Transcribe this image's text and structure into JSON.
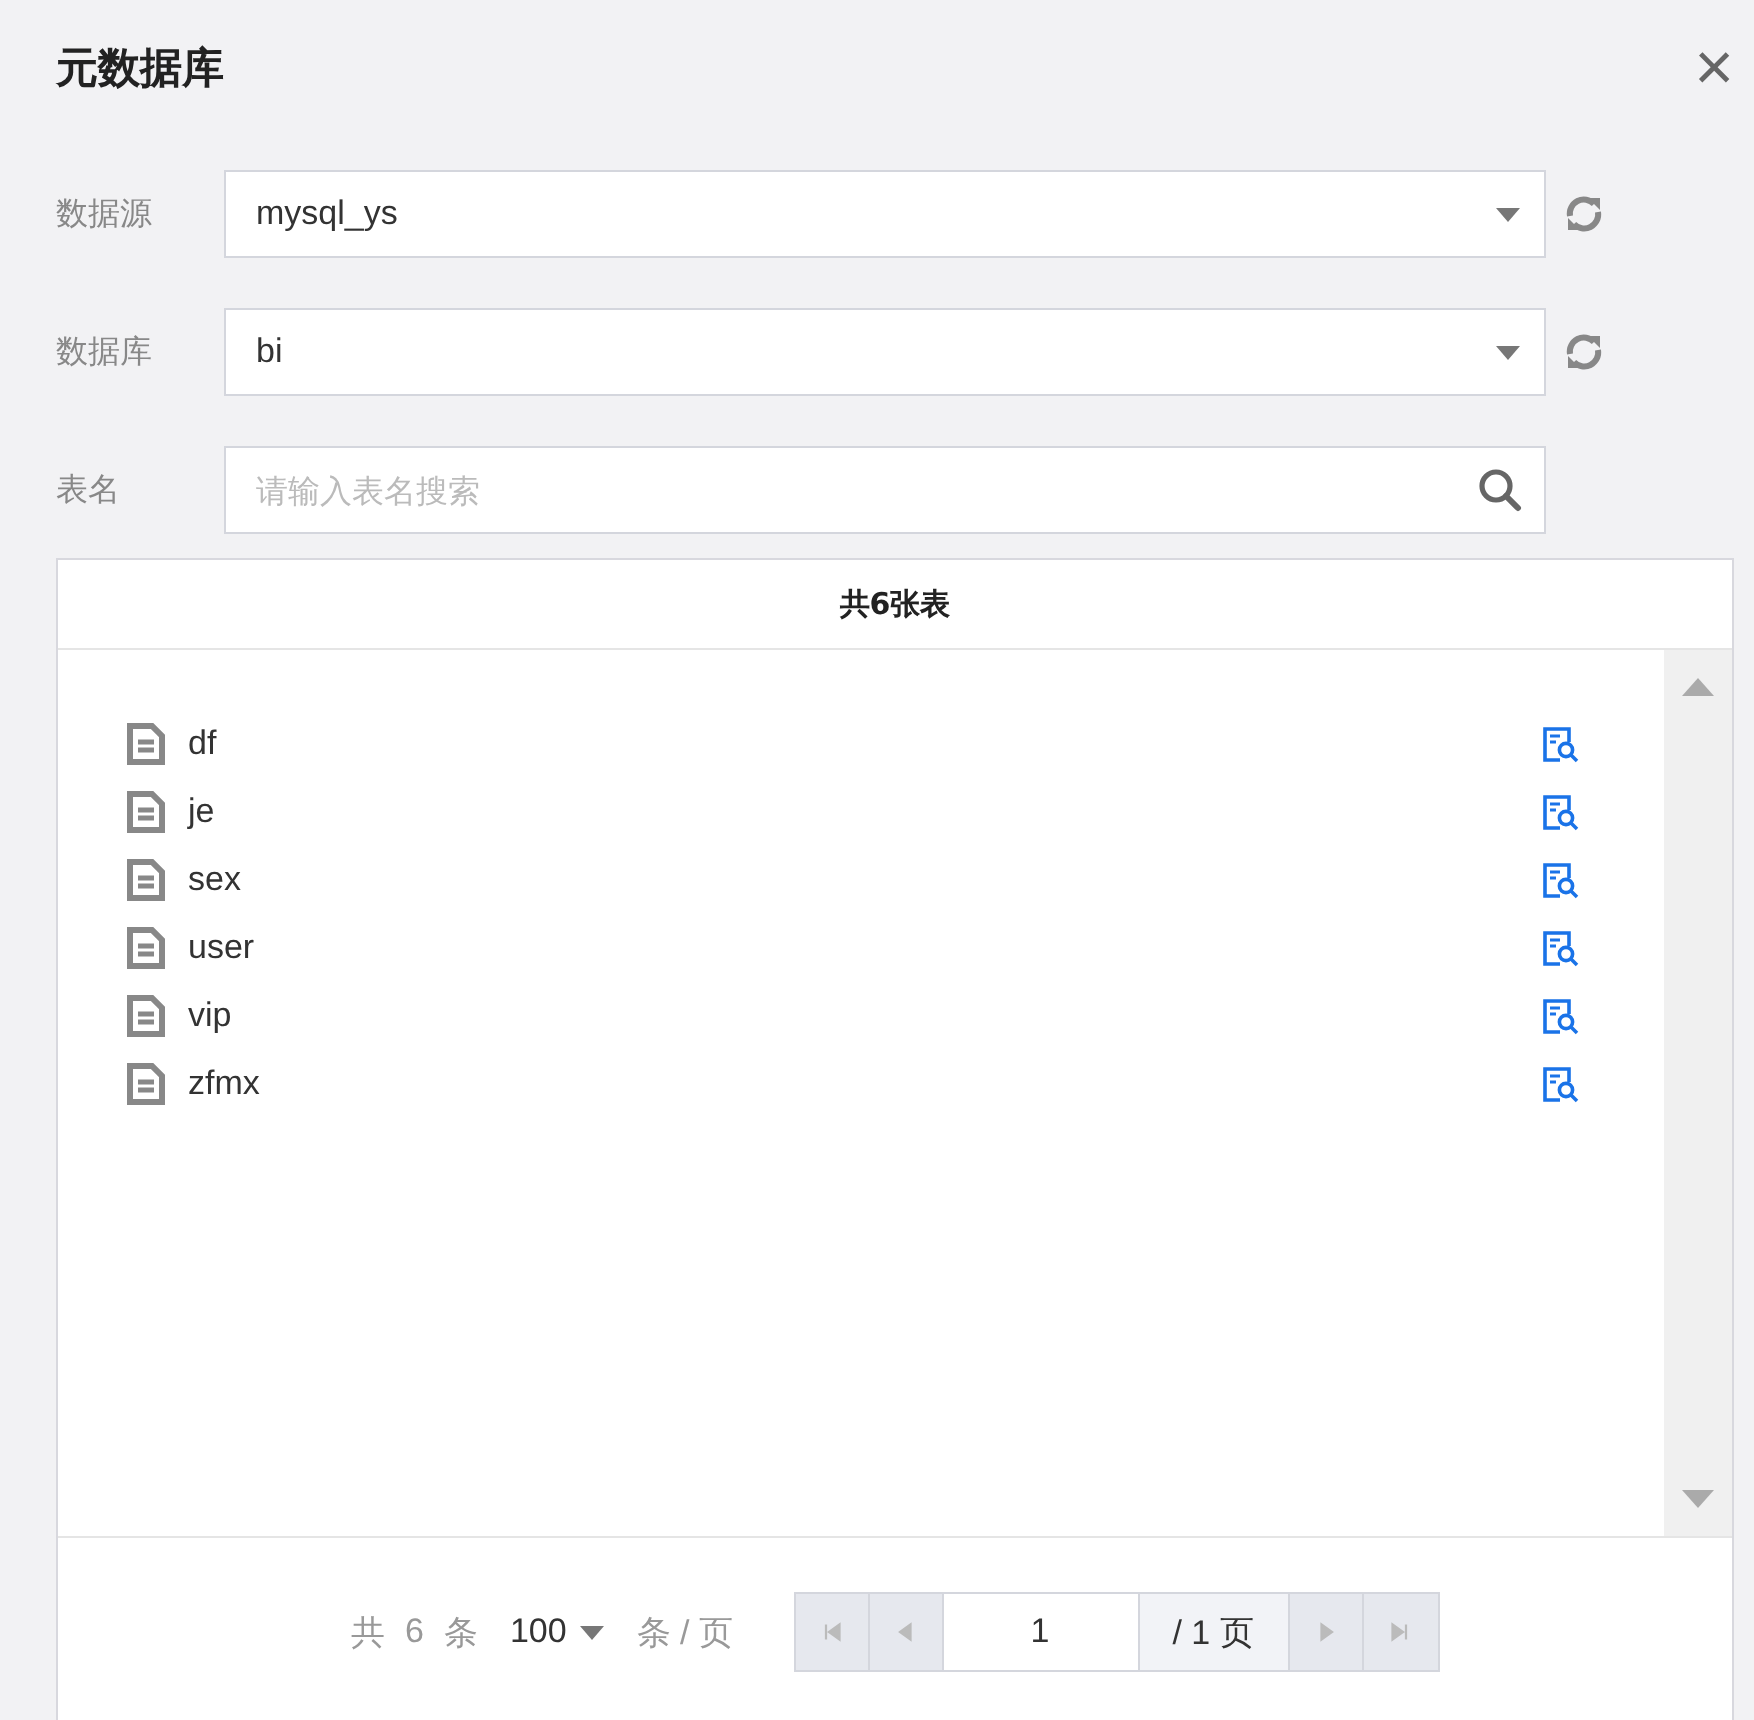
{
  "dialog": {
    "title": "元数据库",
    "close": "×"
  },
  "form": [
    {
      "kind": "select",
      "label": "数据源",
      "value": "mysql_ys",
      "refresh": true
    },
    {
      "kind": "select",
      "label": "数据库",
      "value": "bi",
      "refresh": true
    },
    {
      "kind": "search",
      "label": "表名",
      "placeholder": "请输入表名搜索"
    }
  ],
  "table_list": {
    "header": "共6张表",
    "items": [
      "df",
      "je",
      "sex",
      "user",
      "vip",
      "zfmx"
    ]
  },
  "pagination": {
    "total_prefix": "共",
    "total": "6",
    "total_suffix": "条",
    "page_size": "100",
    "per_page": "条 / 页",
    "page": "1",
    "page_total": "/ 1 页",
    "buttons": [
      {
        "kind": "first",
        "disabled": true
      },
      {
        "kind": "prev",
        "disabled": true
      },
      {
        "kind": "next",
        "disabled": true
      },
      {
        "kind": "last",
        "disabled": true
      }
    ]
  }
}
